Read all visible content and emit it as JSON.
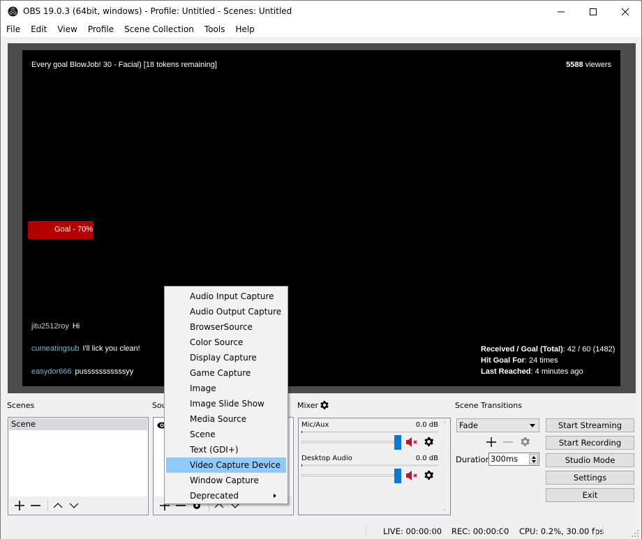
{
  "window": {
    "title": "OBS 19.0.3 (64bit, windows) - Profile: Untitled - Scenes: Untitled",
    "controls": [
      "minimize",
      "maximize",
      "close"
    ]
  },
  "menubar": [
    "File",
    "Edit",
    "View",
    "Profile",
    "Scene Collection",
    "Tools",
    "Help"
  ],
  "preview": {
    "goal_line": "Every goal BlowJob! 30 - Facial) [18 tokens remaining]",
    "viewers_count": "5588",
    "viewers_label": " viewers",
    "goal_bar_label": "Goal - 70%",
    "goal_progress_percent": 70,
    "goal_bar_color": "#b20000",
    "chat": [
      {
        "user": "jitu2512roy",
        "message": "Hi",
        "user_color": "#c8c8c8"
      },
      {
        "user": "cumeatingsub",
        "message": "I'll lick you clean!",
        "user_color": "#7fb6cc"
      },
      {
        "user": "easydor666",
        "message": "pusssssssssssyy",
        "user_color": "#7fb6cc"
      }
    ],
    "stats": [
      {
        "label": "Received / Goal (Total)",
        "value": ": 42 / 60 (1482)"
      },
      {
        "label": "Hit Goal For",
        "value": ": 24 times"
      },
      {
        "label": "Last Reached",
        "value": ": 4 minutes ago"
      }
    ]
  },
  "scenes": {
    "label": "Scenes",
    "items": [
      "Scene"
    ],
    "toolbar": [
      "add",
      "remove",
      "move-up",
      "move-down"
    ]
  },
  "sources": {
    "label": "Sources",
    "label_visible": "Sou"
  },
  "mixer": {
    "label": "Mixer",
    "channels": [
      {
        "name": "Mic/Aux",
        "db": "0.0 dB",
        "volume_percent": 100,
        "muted": true
      },
      {
        "name": "Desktop Audio",
        "db": "0.0 dB",
        "volume_percent": 100,
        "muted": true
      }
    ]
  },
  "transitions": {
    "label": "Scene Transitions",
    "selected": "Fade",
    "duration_label": "Duration",
    "duration_value": "300ms"
  },
  "controls": {
    "buttons": [
      "Start Streaming",
      "Start Recording",
      "Studio Mode",
      "Settings",
      "Exit"
    ]
  },
  "status": {
    "live": "LIVE: 00:00:00",
    "rec": "REC: 00:00:00",
    "cpu": "CPU: 0.2%, 30.00 fps"
  },
  "context_menu": {
    "items": [
      {
        "label": "Audio Input Capture"
      },
      {
        "label": "Audio Output Capture"
      },
      {
        "label": "BrowserSource"
      },
      {
        "label": "Color Source"
      },
      {
        "label": "Display Capture"
      },
      {
        "label": "Game Capture"
      },
      {
        "label": "Image"
      },
      {
        "label": "Image Slide Show"
      },
      {
        "label": "Media Source"
      },
      {
        "label": "Scene"
      },
      {
        "label": "Text (GDI+)"
      },
      {
        "label": "Video Capture Device",
        "highlighted": true
      },
      {
        "label": "Window Capture"
      },
      {
        "label": "Deprecated",
        "submenu": true
      }
    ],
    "highlight_color": "#91c9f7"
  }
}
